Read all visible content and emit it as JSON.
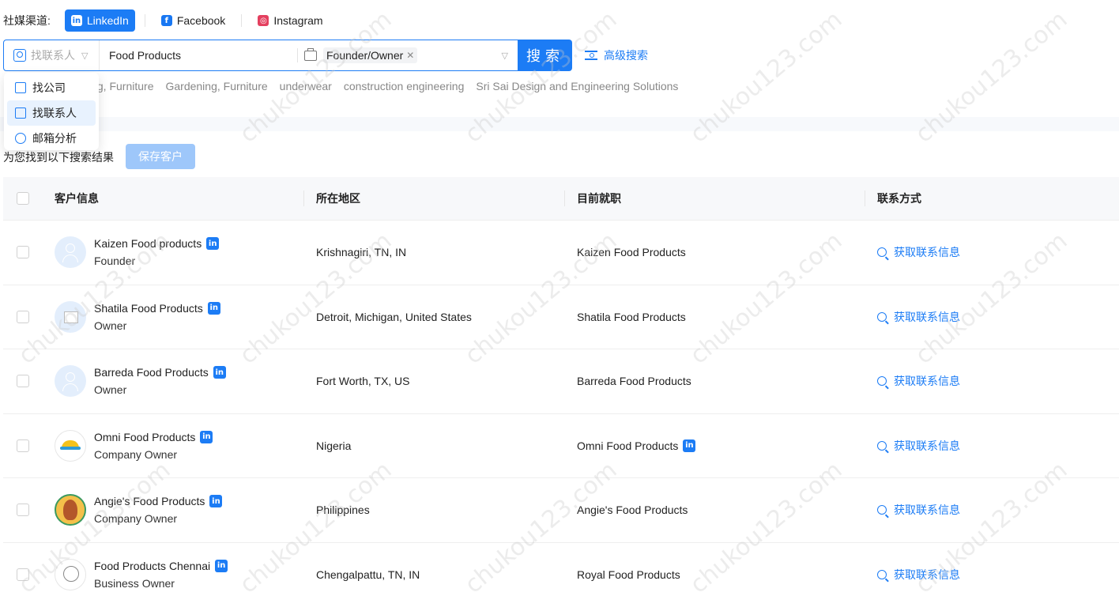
{
  "channels": {
    "label": "社媒渠道:",
    "items": [
      {
        "label": "LinkedIn",
        "icon": "linkedin-icon",
        "active": true
      },
      {
        "label": "Facebook",
        "icon": "facebook-icon",
        "active": false
      },
      {
        "label": "Instagram",
        "icon": "instagram-icon",
        "active": false
      }
    ]
  },
  "search": {
    "type_selected": "找联系人",
    "keyword_value": "Food Products",
    "role_tag": "Founder/Owner",
    "button_label": "搜索",
    "advanced_label": "高级搜索"
  },
  "history": [
    "ing, Furniture",
    "Gardening, Furniture",
    "underwear",
    "construction engineering",
    "Sri Sai Design and Engineering Solutions"
  ],
  "dropdown": {
    "items": [
      {
        "label": "找公司",
        "icon": "building-icon",
        "active": false
      },
      {
        "label": "找联系人",
        "icon": "contact-icon",
        "active": true
      },
      {
        "label": "邮箱分析",
        "icon": "mail-analysis-icon",
        "active": false
      }
    ]
  },
  "results": {
    "text": "为您找到以下搜索结果",
    "save_label": "保存客户"
  },
  "table": {
    "headers": {
      "info": "客户信息",
      "location": "所在地区",
      "job": "目前就职",
      "contact": "联系方式"
    },
    "rows": [
      {
        "name": "Kaizen Food products",
        "title": "Founder",
        "location": "Krishnagiri, TN, IN",
        "job": "Kaizen Food Products",
        "job_linkedin": false,
        "contact": "获取联系信息"
      },
      {
        "name": "Shatila Food Products",
        "title": "Owner",
        "location": "Detroit, Michigan, United States",
        "job": "Shatila Food Products",
        "job_linkedin": false,
        "contact": "获取联系信息"
      },
      {
        "name": "Barreda Food Products",
        "title": "Owner",
        "location": "Fort Worth, TX, US",
        "job": "Barreda Food Products",
        "job_linkedin": false,
        "contact": "获取联系信息"
      },
      {
        "name": "Omni Food Products",
        "title": "Company Owner",
        "location": "Nigeria",
        "job": "Omni Food Products",
        "job_linkedin": true,
        "contact": "获取联系信息"
      },
      {
        "name": "Angie's Food Products",
        "title": "Company Owner",
        "location": "Philippines",
        "job": "Angie's Food Products",
        "job_linkedin": false,
        "contact": "获取联系信息"
      },
      {
        "name": "Food Products Chennai",
        "title": "Business Owner",
        "location": "Chengalpattu, TN, IN",
        "job": "Royal Food Products",
        "job_linkedin": false,
        "contact": "获取联系信息"
      }
    ]
  },
  "watermark": "chukou123.com",
  "colors": {
    "accent": "#1c7cf5",
    "save_disabled": "#9ec7fa"
  }
}
